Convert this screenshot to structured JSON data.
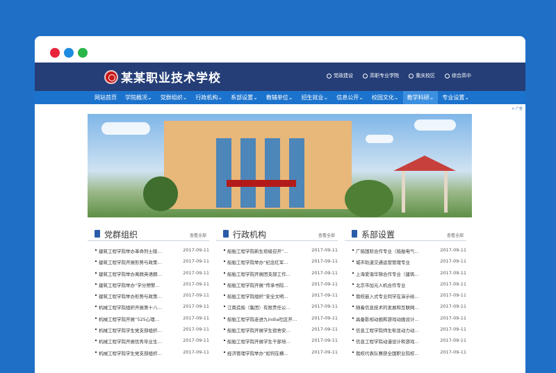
{
  "window": {
    "dot_colors": [
      "#e8243c",
      "#1d8be0",
      "#2bb64a"
    ]
  },
  "header": {
    "school_name": "某某职业技术学校",
    "quick_links": [
      "党政建设",
      "高职专业学院",
      "重庆校区",
      "综合高中"
    ]
  },
  "nav": {
    "items": [
      "网站首页",
      "学院概况",
      "党群组织",
      "行政机构",
      "系部设置",
      "教辅单位",
      "招生就业",
      "信息公开",
      "校园文化",
      "教学科研",
      "专业设置"
    ],
    "active_index": 9
  },
  "ad_label": "× 广告",
  "sections": [
    {
      "title": "党群组织",
      "more": "查看全部",
      "items": [
        {
          "title": "建筑工程学院举办革命烈士陵…",
          "date": "2017-09-11"
        },
        {
          "title": "建筑工程学院开展形势与政策…",
          "date": "2017-09-11"
        },
        {
          "title": "建筑工程学院举办离群英语朗…",
          "date": "2017-09-11"
        },
        {
          "title": "建筑工程学院举办“学分预警…",
          "date": "2017-09-11"
        },
        {
          "title": "建筑工程学院举办形势与政策…",
          "date": "2017-09-11"
        },
        {
          "title": "机械工程学院组织开展第十八…",
          "date": "2017-09-11"
        },
        {
          "title": "机械工程学院开展“525心理…",
          "date": "2017-09-11"
        },
        {
          "title": "机械工程学院学生党支部组织…",
          "date": "2017-09-11"
        },
        {
          "title": "机械工程学院开展优秀毕业生…",
          "date": "2017-09-11"
        },
        {
          "title": "机械工程学院学生党支部组织…",
          "date": "2017-09-11"
        }
      ]
    },
    {
      "title": "行政机构",
      "more": "查看全部",
      "items": [
        {
          "title": "船舶工程学院新生班级召开“…",
          "date": "2017-09-11"
        },
        {
          "title": "船舶工程学院举办“纪念红军…",
          "date": "2017-09-11"
        },
        {
          "title": "船舶工程学院开展团支部工作…",
          "date": "2017-09-11"
        },
        {
          "title": "船舶工程学院开展“传承书院…",
          "date": "2017-09-11"
        },
        {
          "title": "船舶工程学院组织“安全文明…",
          "date": "2017-09-11"
        },
        {
          "title": "江南造船（集团）有限责任公…",
          "date": "2017-09-11"
        },
        {
          "title": "船舶工程学院走进九india社区开…",
          "date": "2017-09-11"
        },
        {
          "title": "船舶工程学院开展学生宿舍安…",
          "date": "2017-09-11"
        },
        {
          "title": "船舶工程学院开展学生干部培…",
          "date": "2017-09-11"
        },
        {
          "title": "经济管理学院举办“如何在横…",
          "date": "2017-09-11"
        }
      ]
    },
    {
      "title": "系部设置",
      "more": "查看全部",
      "items": [
        {
          "title": "广船国际合作专业（船舶电气…",
          "date": "2017-09-11"
        },
        {
          "title": "城市轨道交通运营管理专业",
          "date": "2017-09-11"
        },
        {
          "title": "上海爱谐华锦合作专业（建筑…",
          "date": "2017-09-11"
        },
        {
          "title": "北京市加元人机合作专业",
          "date": "2017-09-11"
        },
        {
          "title": "我校嵌入式专业同学在演示给…",
          "date": "2017-09-11"
        },
        {
          "title": "随着信息技术的发展和互联网…",
          "date": "2017-09-11"
        },
        {
          "title": "具备影视动画和游戏动画设计…",
          "date": "2017-09-11"
        },
        {
          "title": "信息工程学院师生彰显动力动…",
          "date": "2017-09-11"
        },
        {
          "title": "信息工程学院动漫设计和游戏…",
          "date": "2017-09-11"
        },
        {
          "title": "我校代表队赛获全国职业院校…",
          "date": "2017-09-11"
        }
      ]
    }
  ]
}
